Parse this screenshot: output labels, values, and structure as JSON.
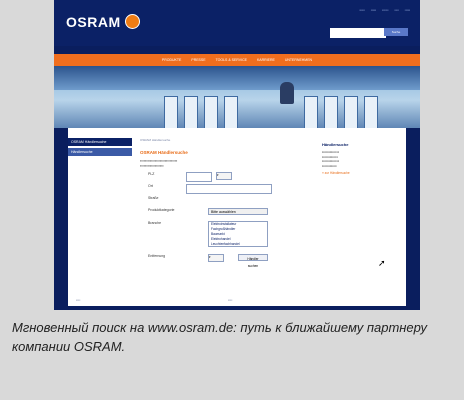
{
  "header": {
    "logo_text": "OSRAM",
    "search_button": "Suche"
  },
  "nav": [
    "PRODUKTE",
    "PRESSE",
    "TOOLS & SERVICE",
    "KARRIERE",
    "UNTERNEHMEN"
  ],
  "leftnav": [
    "OSRAM Händlersuche",
    "Händlersuche"
  ],
  "breadcrumb": "OSRAM Händlersuche",
  "form": {
    "title": "OSRAM Händlersuche",
    "fields": {
      "plz": "PLZ",
      "ort": "Ort",
      "strasse": "Straße",
      "produktkategorie": "Produktkategorie",
      "branche": "Branche",
      "entfernung": "Entfernung"
    },
    "dropdown_value": "Bitte auswählen",
    "list_options": [
      "Elektroinstallateur",
      "Fachgroßhändler",
      "Baumarkt",
      "Elektrohandel",
      "Leuchtenfachhandel"
    ],
    "submit": "Händler suchen"
  },
  "sidebar": {
    "heading": "Händlersuche",
    "link": "» zur Händlersuche"
  },
  "caption": "Мгновенный поиск на www.osram.de: путь к ближайшему партнеру компании OSRAM.",
  "colors": {
    "navy": "#0b2166",
    "orange": "#f06e1e"
  }
}
